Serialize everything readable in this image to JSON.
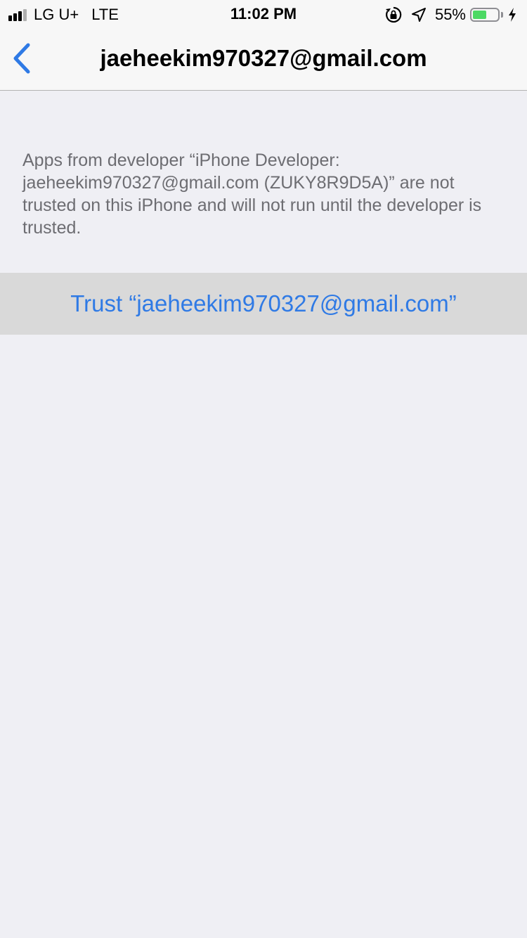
{
  "status_bar": {
    "carrier": "LG U+",
    "network": "LTE",
    "time": "11:02 PM",
    "battery_percent": "55%",
    "battery_level": 0.55,
    "icons": [
      "signal-icon",
      "orientation-lock-icon",
      "location-icon",
      "battery-icon",
      "charging-icon"
    ]
  },
  "nav": {
    "back_icon": "chevron-left-icon",
    "title": "jaeheekim970327@gmail.com"
  },
  "body": {
    "description": "Apps from developer “iPhone Developer: jaeheekim970327@gmail.com (ZUKY8R9D5A)” are not trusted on this iPhone and will not run until the developer is trusted.",
    "trust_button_label": "Trust “jaeheekim970327@gmail.com”"
  },
  "colors": {
    "accent": "#2f7ae5",
    "background": "#efeff4",
    "cell_highlight": "#d9d9d9",
    "battery_green": "#4cd964"
  }
}
